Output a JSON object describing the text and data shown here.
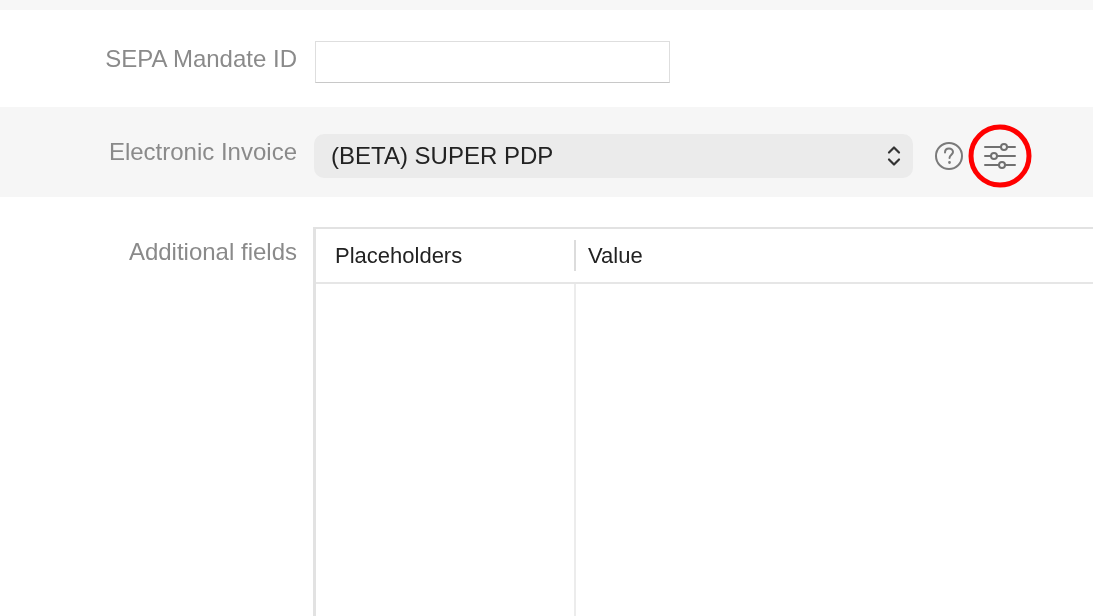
{
  "sepa_mandate": {
    "label": "SEPA Mandate ID"
  },
  "electronic_invoice": {
    "label": "Electronic Invoice",
    "value": "(BETA) SUPER PDP",
    "settings_button": {
      "highlighted": true
    }
  },
  "additional_fields": {
    "label": "Additional fields",
    "table": {
      "columns": [
        "Placeholders",
        "Value"
      ]
    }
  }
}
